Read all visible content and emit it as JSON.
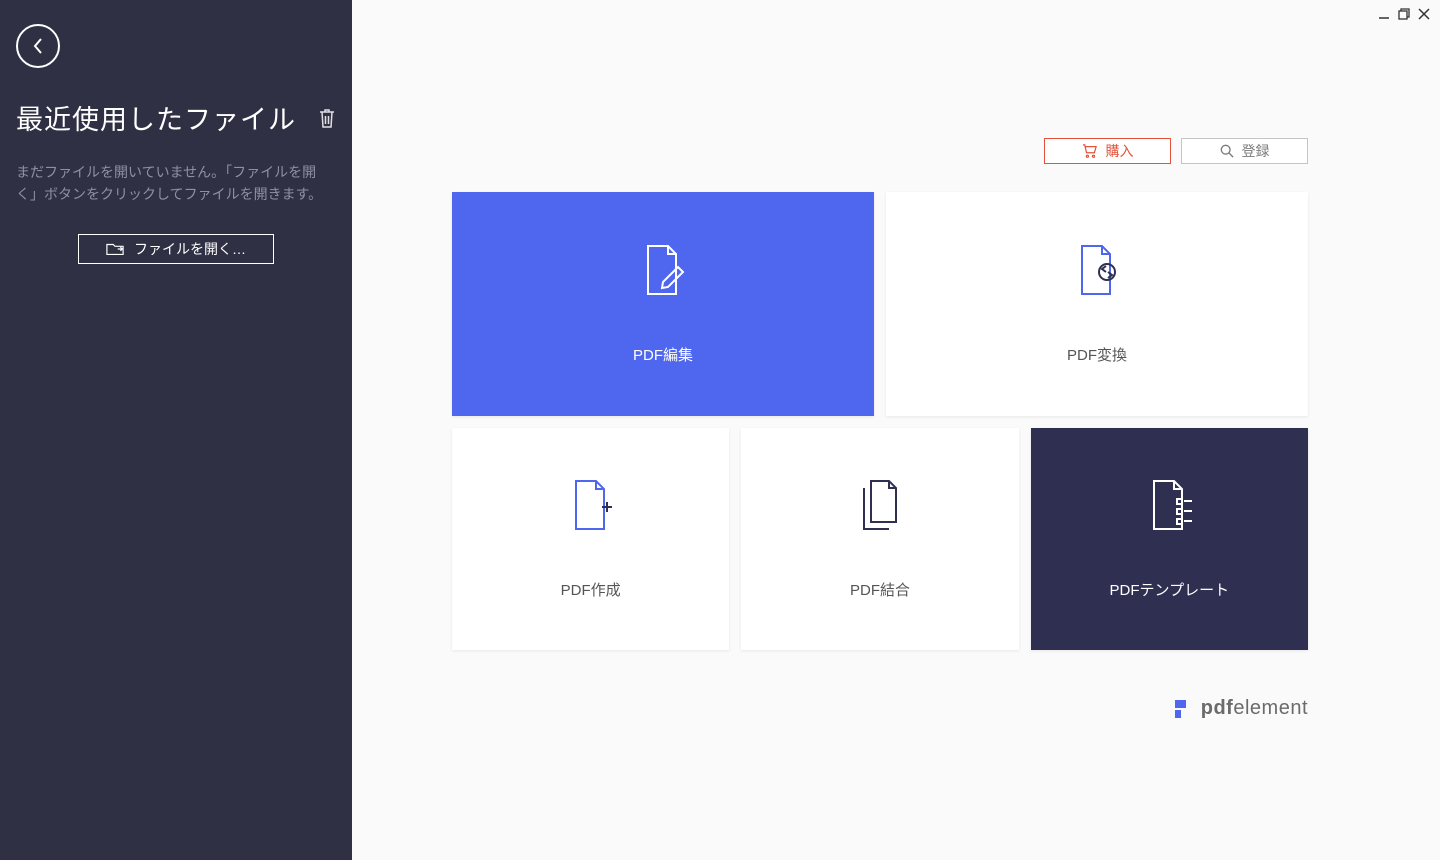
{
  "sidebar": {
    "title": "最近使用したファイル",
    "message": "まだファイルを開いていません。「ファイルを開く」ボタンをクリックしてファイルを開きます。",
    "open_button": "ファイルを開く…"
  },
  "toolbar": {
    "buy": "購入",
    "register": "登録"
  },
  "cards": {
    "edit": "PDF編集",
    "convert": "PDF変換",
    "create": "PDF作成",
    "combine": "PDF結合",
    "template": "PDFテンプレート"
  },
  "branding": {
    "prefix": "pdf",
    "suffix": "element"
  },
  "colors": {
    "sidebar_bg": "#2f3044",
    "primary": "#4f66ee",
    "template_bg": "#2f3051",
    "accent_buy": "#e2543a"
  }
}
